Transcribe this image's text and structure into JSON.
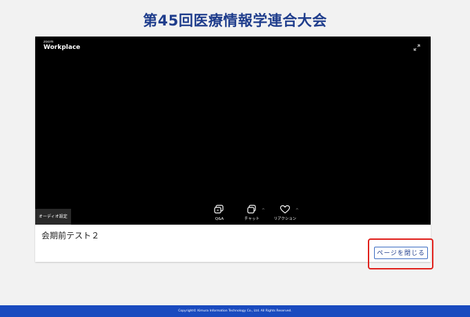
{
  "page": {
    "title": "第45回医療情報学連合大会"
  },
  "player": {
    "brand_small": "zoom",
    "brand_main": "Workplace",
    "audio_settings_label": "オーディオ設定",
    "controls": {
      "qa_label": "Q&A",
      "chat_label": "チャット",
      "reaction_label": "リアクション"
    }
  },
  "meeting": {
    "title": "会期前テスト２"
  },
  "actions": {
    "close_page_label": "ページを閉じる"
  },
  "footer": {
    "copyright": "Copyright© Kimura Information Technology Co., Ltd. All Rights Reserved."
  },
  "colors": {
    "title": "#1f3d8c",
    "footer_bg": "#1a4bbf",
    "highlight": "#e0201b",
    "player_bg": "#000000"
  }
}
